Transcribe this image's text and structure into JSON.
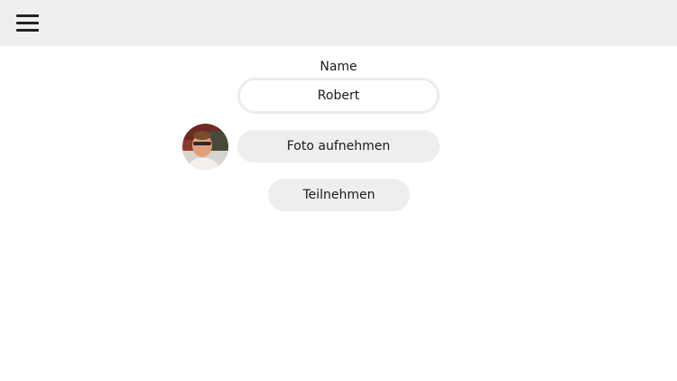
{
  "header": {
    "menu_icon": "hamburger-menu-icon"
  },
  "form": {
    "name_label": "Name",
    "name_value": "Robert",
    "avatar_icon": "user-photo-avatar",
    "photo_button_label": "Foto aufnehmen",
    "join_button_label": "Teilnehmen"
  },
  "colors": {
    "topbar_bg": "#efefef",
    "button_bg": "#eeeeee",
    "input_border": "#ececec",
    "text": "#1a1a1a"
  }
}
